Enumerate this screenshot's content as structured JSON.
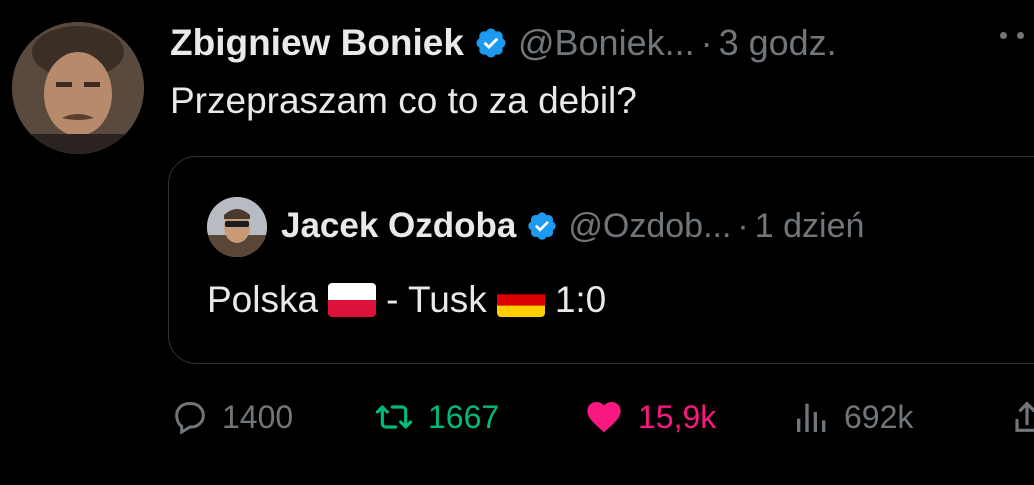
{
  "tweet": {
    "author": {
      "display_name": "Zbigniew Boniek",
      "handle": "@Boniek...",
      "verified_icon": "verified-badge-icon"
    },
    "separator": "·",
    "time": "3 godz.",
    "text": "Przepraszam co to za debil?",
    "more_icon": "more-options-icon"
  },
  "quoted": {
    "author": {
      "display_name": "Jacek Ozdoba",
      "handle": "@Ozdob...",
      "verified_icon": "verified-badge-icon"
    },
    "separator": "·",
    "time": "1 dzień",
    "text_part1": "Polska",
    "text_part2": "- Tusk",
    "text_part3": "1:0",
    "flag1": "poland-flag",
    "flag2": "germany-flag"
  },
  "actions": {
    "reply_count": "1400",
    "retweet_count": "1667",
    "like_count": "15,9k",
    "views_count": "692k"
  },
  "colors": {
    "background": "#000000",
    "text": "#e7e9ea",
    "muted": "#71767b",
    "verified": "#1d9bf0",
    "retweet": "#00ba7c",
    "like": "#f91880",
    "border": "#2f3336"
  }
}
